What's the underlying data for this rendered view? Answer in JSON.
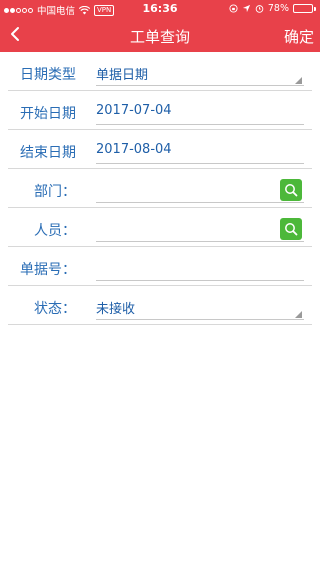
{
  "status_bar": {
    "carrier": "中国电信",
    "vpn": "VPN",
    "time": "16:36",
    "battery": "78%",
    "battery_level": 0.78
  },
  "nav": {
    "title": "工单查询",
    "confirm_label": "确定"
  },
  "form": {
    "date_type": {
      "label": "日期类型",
      "value": "单据日期"
    },
    "start_date": {
      "label": "开始日期",
      "value": "2017-07-04"
    },
    "end_date": {
      "label": "结束日期",
      "value": "2017-08-04"
    },
    "department": {
      "label": "部门：",
      "value": ""
    },
    "personnel": {
      "label": "人员：",
      "value": ""
    },
    "doc_number": {
      "label": "单据号：",
      "value": ""
    },
    "status": {
      "label": "状态：",
      "value": "未接收"
    }
  },
  "colors": {
    "nav_bg": "#e8414a",
    "label_blue": "#2a6db5",
    "search_green": "#4cb83a"
  }
}
